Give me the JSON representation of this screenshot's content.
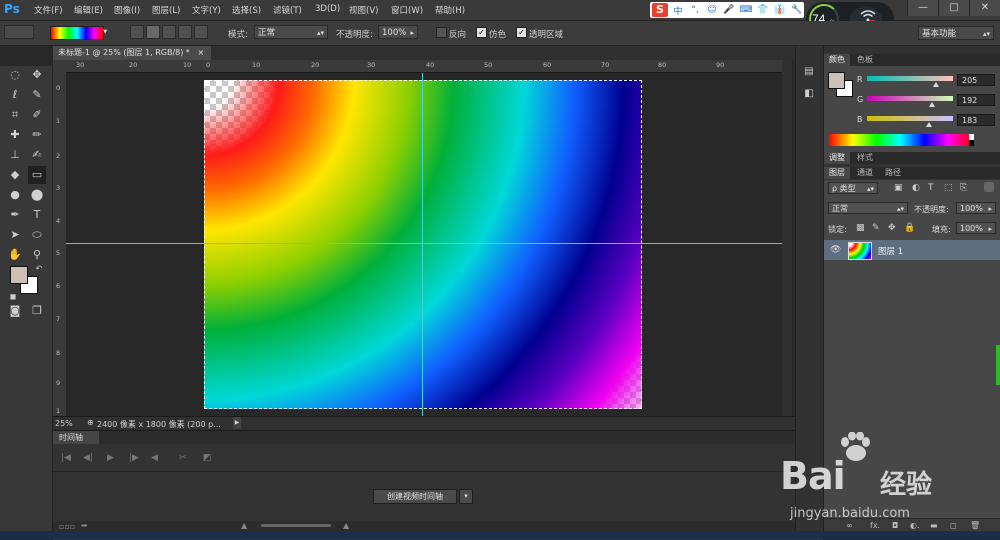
{
  "app": {
    "logo": "Ps"
  },
  "menu": [
    "文件(F)",
    "编辑(E)",
    "图像(I)",
    "图层(L)",
    "文字(Y)",
    "选择(S)",
    "滤镜(T)",
    "3D(D)",
    "视图(V)",
    "窗口(W)",
    "帮助(H)"
  ],
  "window_controls": {
    "minimize": "—",
    "maximize": "□",
    "close": "✕"
  },
  "ime": {
    "logo": "S",
    "items": [
      "中",
      "°,",
      "☺",
      "🎤",
      "⌨",
      "👕",
      "👔",
      "🔧"
    ]
  },
  "perf": {
    "value": "74",
    "unit": "%"
  },
  "options": {
    "mode_label": "模式:",
    "mode_value": "正常",
    "opacity_label": "不透明度:",
    "opacity_value": "100%",
    "reverse_label": "反向",
    "dither_label": "仿色",
    "transparency_label": "透明区域",
    "reverse_checked": false,
    "dither_checked": true,
    "transparency_checked": true,
    "workspace": "基本功能"
  },
  "document": {
    "tab_title": "未标题-1 @ 25% (图层 1, RGB/8) *",
    "tab_close": "×",
    "zoom": "25%",
    "info": "2400 像素 x 1800 像素 (200 p..."
  },
  "rulers": {
    "h_labels": [
      "30",
      "20",
      "10",
      "0",
      "10",
      "20",
      "30",
      "40",
      "50",
      "60",
      "70",
      "80",
      "90"
    ],
    "v_labels": [
      "0",
      "1",
      "2",
      "3",
      "4",
      "5",
      "6",
      "7",
      "8",
      "9",
      "1"
    ]
  },
  "timeline": {
    "tab": "时间轴",
    "create_button": "创建视频时间轴"
  },
  "color_panel": {
    "tabs": [
      "颜色",
      "色板"
    ],
    "channels": [
      {
        "label": "R",
        "value": "205",
        "level": 0.8
      },
      {
        "label": "G",
        "value": "192",
        "level": 0.75
      },
      {
        "label": "B",
        "value": "183",
        "level": 0.72
      }
    ],
    "foreground": "#cdc0b7",
    "background": "#ffffff"
  },
  "adjust_panel": {
    "tabs": [
      "调整",
      "样式"
    ]
  },
  "layers_panel": {
    "tabs": [
      "图层",
      "通道",
      "路径"
    ],
    "filter_label": "ρ 类型",
    "blend_mode": "正常",
    "opacity_label": "不透明度:",
    "opacity_value": "100%",
    "lock_label": "锁定:",
    "fill_label": "填充:",
    "fill_value": "100%",
    "layers": [
      {
        "name": "图层 1",
        "visible": true,
        "selected": true
      }
    ],
    "footer_icons": [
      "∞",
      "fx.",
      "◘",
      "◐.",
      "▬",
      "◻",
      "🗑"
    ]
  },
  "watermark": {
    "logo": "Bai",
    "brand": "经验",
    "url": "jingyan.baidu.com"
  },
  "colors": {
    "accent": "#31a8ff",
    "guide": "#3dd6d0",
    "selected_layer": "#5f6d80"
  }
}
